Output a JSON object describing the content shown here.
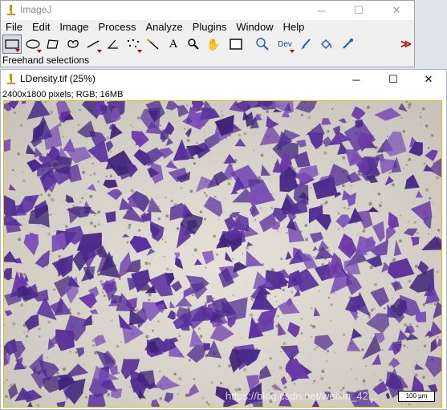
{
  "main_window": {
    "title": "ImageJ",
    "menu": [
      "File",
      "Edit",
      "Image",
      "Process",
      "Analyze",
      "Plugins",
      "Window",
      "Help"
    ],
    "tools": [
      {
        "name": "rectangle-tool",
        "selected": true
      },
      {
        "name": "oval-tool",
        "selected": false
      },
      {
        "name": "polygon-tool",
        "selected": false
      },
      {
        "name": "freehand-tool",
        "selected": false
      },
      {
        "name": "line-tool",
        "selected": false
      },
      {
        "name": "angle-tool",
        "selected": false
      },
      {
        "name": "point-tool",
        "selected": false
      },
      {
        "name": "wand-tool",
        "selected": false
      },
      {
        "name": "text-tool",
        "label": "A",
        "selected": false
      },
      {
        "name": "magnifier-tool",
        "selected": false
      },
      {
        "name": "hand-tool",
        "selected": false
      },
      {
        "name": "color-picker-tool",
        "selected": false
      },
      {
        "name": "zoom-tool",
        "selected": false
      },
      {
        "name": "developer-menu",
        "label": "Dev",
        "selected": false
      },
      {
        "name": "brush-tool",
        "selected": false
      },
      {
        "name": "flood-fill-tool",
        "selected": false
      },
      {
        "name": "pencil-tool",
        "selected": false
      },
      {
        "name": "more-tools",
        "label": "≫",
        "selected": false
      }
    ],
    "status": "Freehand selections"
  },
  "image_window": {
    "title": "LDensity.tif (25%)",
    "info": "2400x1800 pixels; RGB; 16MB",
    "scale_bar": "100 μm",
    "watermark": "https://blog.csdn.net/weixin_42..."
  }
}
